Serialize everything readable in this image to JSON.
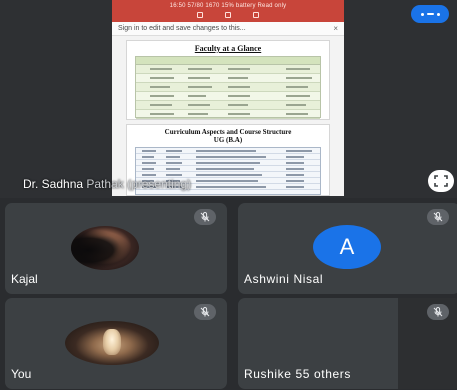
{
  "presentation": {
    "doc_topline": "16:50 57/80 1670 15% battery   Read only",
    "signin_banner": "Sign in to edit and save changes to this...",
    "signin_close": "×",
    "faculty_heading": "Faculty at a Glance",
    "curriculum_heading_line1": "Curriculum Aspects and Course Structure",
    "curriculum_heading_line2": "UG (B.A)",
    "presenter_name_part": "Dr. Sadhna",
    "presenter_status_part": " Pathak (presenting)"
  },
  "tiles": [
    {
      "name": "Kajal",
      "avatar": "photo"
    },
    {
      "name": "Ashwini Nisal",
      "avatar_letter": "A",
      "avatar_color": "#1a73e8"
    },
    {
      "name": "You",
      "avatar": "photo"
    },
    {
      "name": "Rushike",
      "overlay_text": "55 others"
    }
  ],
  "icons": {
    "mic": "mic-off-icon",
    "more": "more-options-icon",
    "expand": "fullscreen-icon"
  },
  "colors": {
    "background": "#2a2c2f",
    "tile": "#3c4043",
    "accent_blue": "#1a73e8",
    "doc_header_red": "#c8453a"
  }
}
